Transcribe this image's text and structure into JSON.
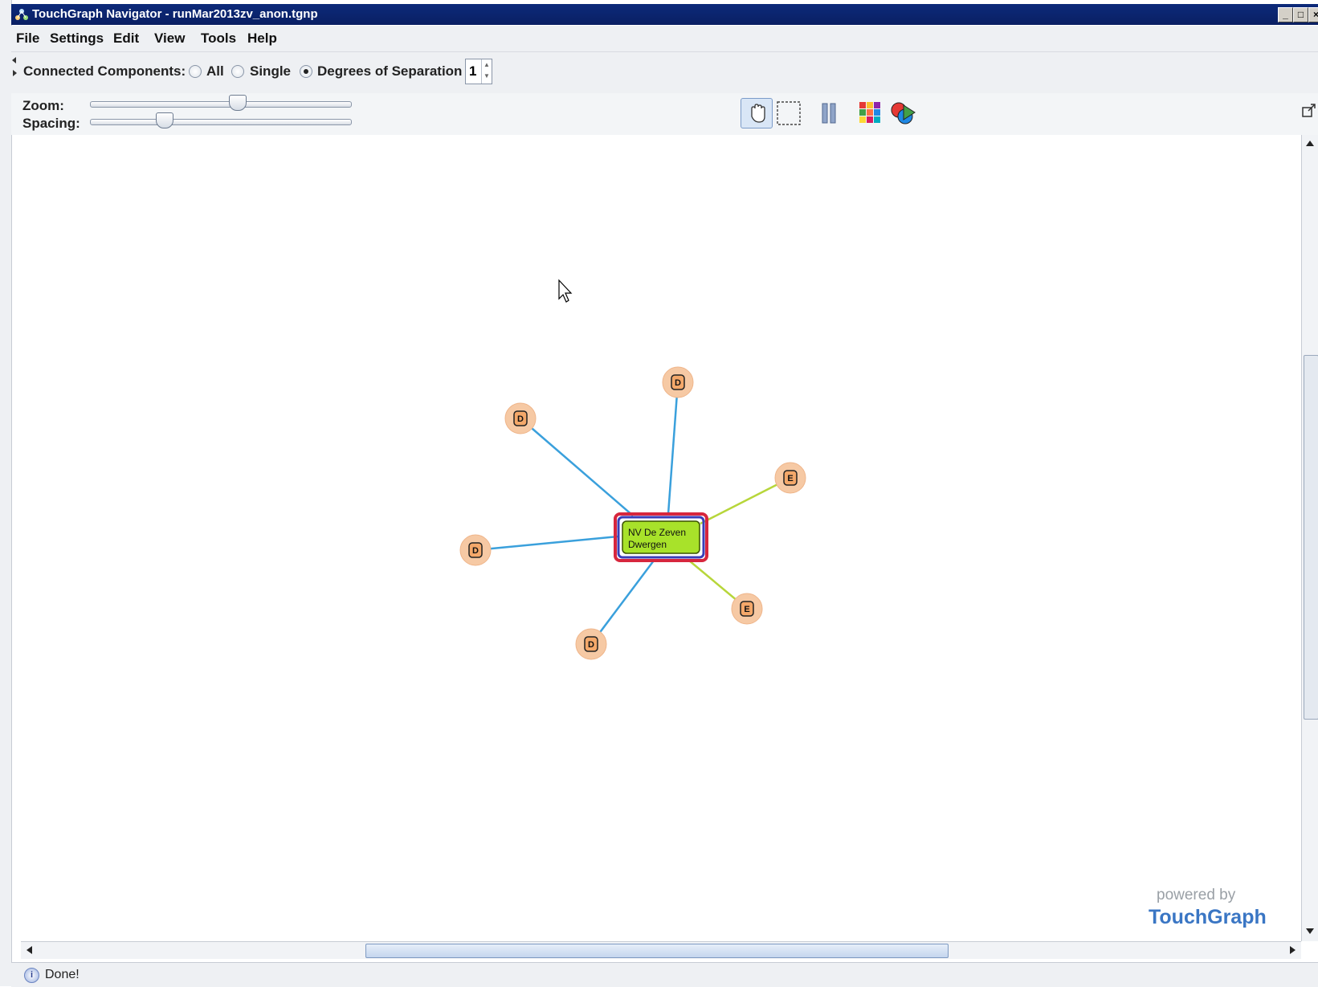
{
  "window": {
    "title": "TouchGraph Navigator - runMar2013zv_anon.tgnp",
    "buttons": [
      "minimize",
      "maximize",
      "close"
    ]
  },
  "menu": [
    "File",
    "Settings",
    "Edit",
    "View",
    "Tools",
    "Help"
  ],
  "toolbar": {
    "connected_components_label": "Connected Components:",
    "options": [
      {
        "label": "All",
        "selected": false
      },
      {
        "label": "Single",
        "selected": false
      },
      {
        "label": "Degrees of Separation",
        "selected": true
      }
    ],
    "degrees_value": "1",
    "zoom_label": "Zoom:",
    "spacing_label": "Spacing:",
    "zoom_level": 0.57,
    "spacing_level": 0.27,
    "tools": [
      {
        "name": "hand-tool",
        "active": true
      },
      {
        "name": "select-rect-tool",
        "active": false
      },
      {
        "name": "pause-tool",
        "active": false
      },
      {
        "name": "color-grid-tool",
        "active": false
      },
      {
        "name": "color-shapes-tool",
        "active": false
      }
    ]
  },
  "graph": {
    "center": {
      "label_line1": "NV De Zeven",
      "label_line2": "Dwergen"
    },
    "nodes": [
      {
        "label": "D",
        "type": "D"
      },
      {
        "label": "D",
        "type": "D"
      },
      {
        "label": "E",
        "type": "E"
      },
      {
        "label": "D",
        "type": "D"
      },
      {
        "label": "E",
        "type": "E"
      },
      {
        "label": "D",
        "type": "D"
      }
    ],
    "colors": {
      "d_edge": "#3aa0dc",
      "e_edge": "#b7d63a",
      "node_fill": "#f6c9a4",
      "center_fill": "#a8e22a",
      "center_border": "#d7263d"
    }
  },
  "status": {
    "text": "Done!"
  },
  "watermark": {
    "line1": "powered by",
    "line2": "TouchGraph"
  }
}
